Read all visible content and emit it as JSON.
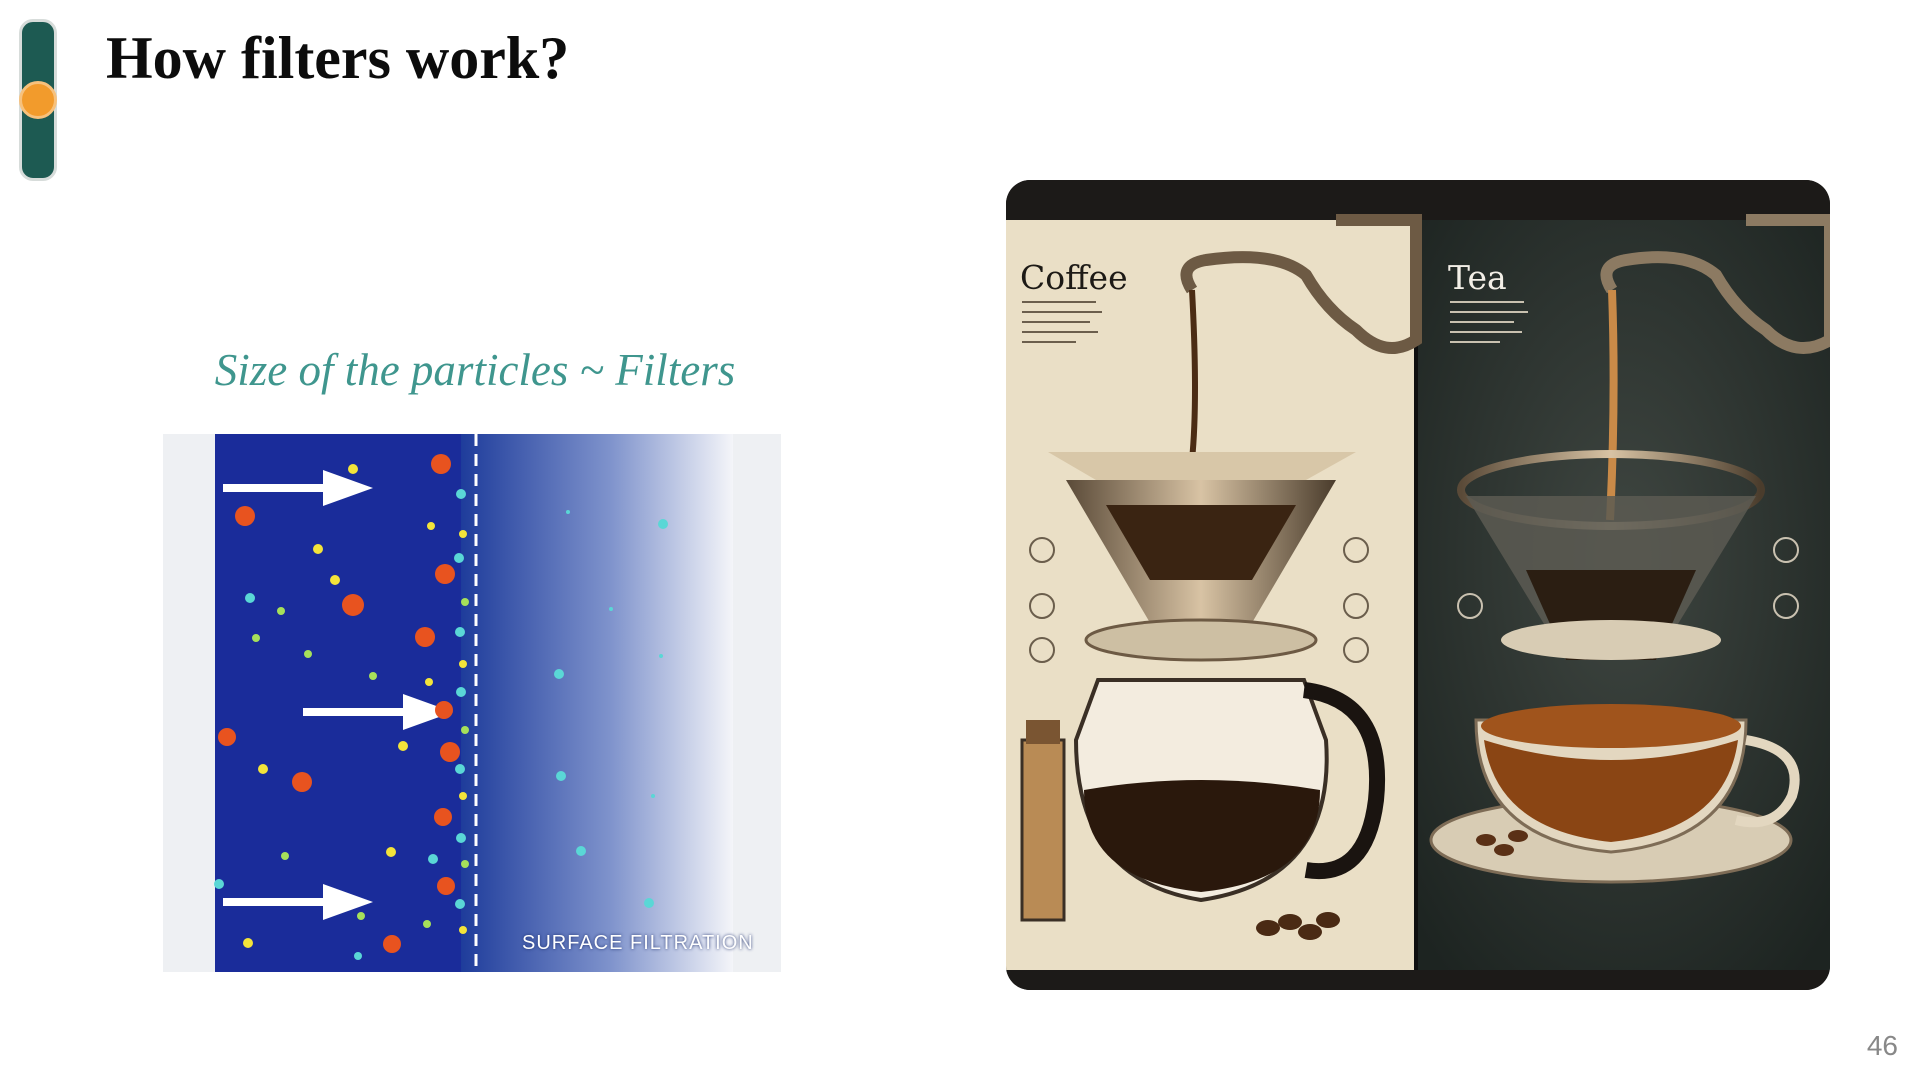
{
  "slide": {
    "title": "How filters work?",
    "caption": "Size of the particles ~ Filters",
    "page_number": "46"
  },
  "filtration_figure": {
    "label": "SURFACE FILTRATION"
  },
  "brew_figure": {
    "left_label": "Coffee",
    "right_label": "Tea"
  },
  "colors": {
    "accent_dark": "#1d5a52",
    "accent_orange": "#f29b2c",
    "caption_teal": "#3f968e"
  }
}
